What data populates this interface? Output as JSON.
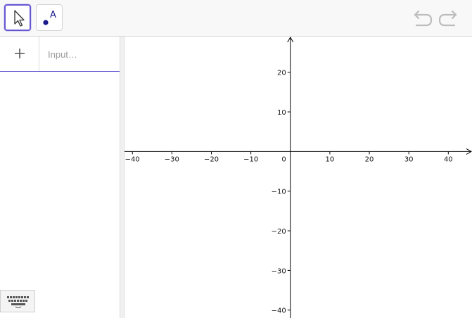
{
  "toolbar": {
    "tools": [
      {
        "name": "Move",
        "icon": "arrow-cursor-icon",
        "selected": true
      },
      {
        "name": "Point",
        "icon": "point-icon",
        "glyph": "A",
        "selected": false
      }
    ],
    "undo_icon": "undo-icon",
    "redo_icon": "redo-icon",
    "accent_color": "#6557d2"
  },
  "algebra": {
    "add_icon": "plus-icon",
    "input_placeholder": "Input…",
    "keyboard_icon": "keyboard-icon"
  },
  "graphics": {
    "x_range": [
      -42,
      46
    ],
    "y_range": [
      -42,
      29
    ],
    "x_ticks": [
      -40,
      -30,
      -20,
      -10,
      10,
      20,
      30,
      40
    ],
    "y_ticks": [
      20,
      10,
      -10,
      -20,
      -30,
      -40
    ],
    "origin_label": "0",
    "grid": false
  }
}
